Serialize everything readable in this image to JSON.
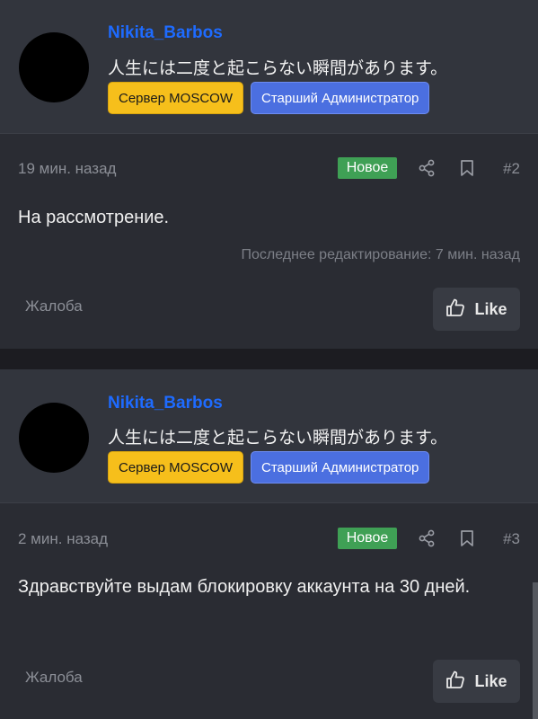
{
  "posts": [
    {
      "username": "Nikita_Barbos",
      "status": "人生には二度と起こらない瞬間があります。",
      "server_badge": "Сервер MOSCOW",
      "role_badge": "Старший Администратор",
      "time": "19 мин. назад",
      "new_label": "Новое",
      "number": "#2",
      "body": "На рассмотрение.",
      "edited": "Последнее редактирование: 7 мин. назад",
      "report_label": "Жалоба",
      "like_label": "Like"
    },
    {
      "username": "Nikita_Barbos",
      "status": "人生には二度と起こらない瞬間があります。",
      "server_badge": "Сервер MOSCOW",
      "role_badge": "Старший Администратор",
      "time": "2 мин. назад",
      "new_label": "Новое",
      "number": "#3",
      "body": "Здравствуйте выдам блокировку аккаунта на 30 дней.",
      "report_label": "Жалоба",
      "like_label": "Like"
    }
  ],
  "icons": {
    "share": "share-icon",
    "bookmark": "bookmark-icon",
    "like": "thumbs-up-icon"
  },
  "colors": {
    "username": "#1e6bff",
    "server_badge": "#f6bf1b",
    "role_badge": "#4b6fe0",
    "new_badge": "#3fa055",
    "background": "#2a2c33"
  }
}
